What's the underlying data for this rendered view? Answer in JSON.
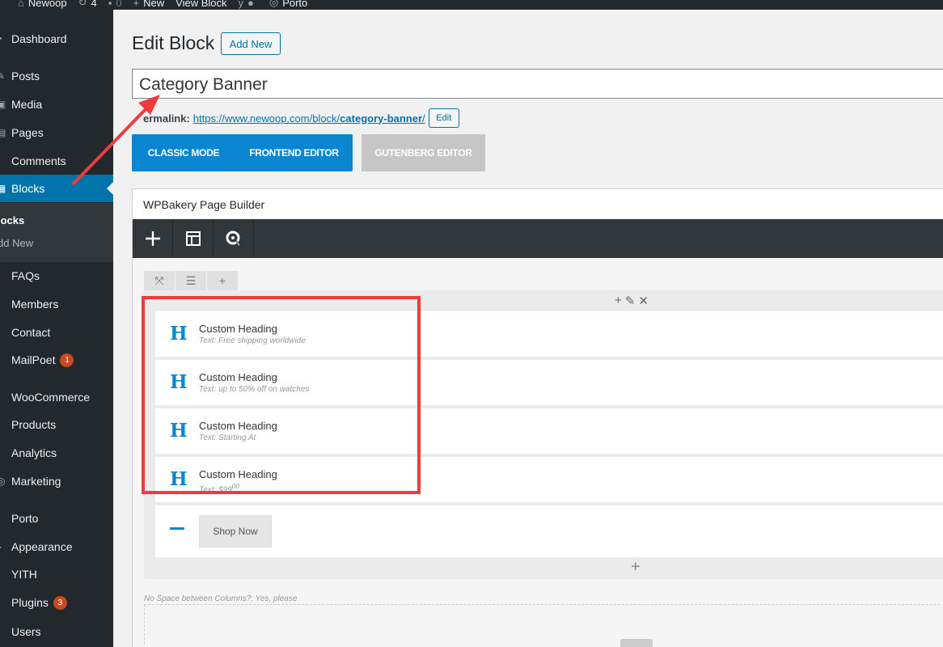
{
  "adminbar": {
    "site_name": "Newoop",
    "updates": "4",
    "comments": "0",
    "new_label": "New",
    "view_label": "View Block",
    "theme": "Porto"
  },
  "sidebar": {
    "items": [
      {
        "label": "Dashboard",
        "icon": "dashboard-icon"
      },
      {
        "label": "Posts",
        "icon": "pin-icon"
      },
      {
        "label": "Media",
        "icon": "media-icon"
      },
      {
        "label": "Pages",
        "icon": "page-icon"
      },
      {
        "label": "Comments",
        "icon": "comment-icon"
      },
      {
        "label": "Blocks",
        "icon": "block-icon"
      },
      {
        "label": "FAQs",
        "icon": "faq-icon"
      },
      {
        "label": "Members",
        "icon": "members-icon"
      },
      {
        "label": "Contact",
        "icon": "contact-icon"
      },
      {
        "label": "MailPoet",
        "icon": "mail-icon",
        "badge": "1"
      },
      {
        "label": "WooCommerce",
        "icon": "woo-icon"
      },
      {
        "label": "Products",
        "icon": "products-icon"
      },
      {
        "label": "Analytics",
        "icon": "analytics-icon"
      },
      {
        "label": "Marketing",
        "icon": "marketing-icon"
      },
      {
        "label": "Porto",
        "icon": "porto-icon"
      },
      {
        "label": "Appearance",
        "icon": "appearance-icon"
      },
      {
        "label": "YITH",
        "icon": "yith-icon"
      },
      {
        "label": "Plugins",
        "icon": "plugins-icon",
        "badge": "3"
      },
      {
        "label": "Users",
        "icon": "users-icon"
      }
    ],
    "submenu": {
      "blocks": "locks",
      "add_new": "dd New"
    }
  },
  "main": {
    "title": "Edit Block",
    "add_new": "Add New",
    "post_title": "Category Banner",
    "permalink_label": "ermalink:",
    "permalink_base": "https://www.newoop.com/block/",
    "permalink_slug": "category-banner",
    "permalink_tail": "/",
    "permalink_edit": "Edit",
    "mode_classic": "CLASSIC MODE",
    "mode_frontend": "FRONTEND EDITOR",
    "mode_gutenberg": "GUTENBERG EDITOR"
  },
  "wpb": {
    "title": "WPBakery Page Builder",
    "elements": [
      {
        "name": "Custom Heading",
        "desc": "Text: Free shipping worldwide"
      },
      {
        "name": "Custom Heading",
        "desc": "Text: up to 50% off on watches"
      },
      {
        "name": "Custom Heading",
        "desc": "Text: Starting At"
      },
      {
        "name": "Custom Heading",
        "desc": "Text: $99",
        "sup": "00"
      }
    ],
    "button_label": "Shop Now",
    "heading_glyph": "H",
    "nospace_label": "No Space between Columns?: Yes, please"
  },
  "colors": {
    "wp_blue": "#0073aa",
    "wpb_blue": "#0a86d0",
    "annotation_red": "#ef3b3b"
  }
}
